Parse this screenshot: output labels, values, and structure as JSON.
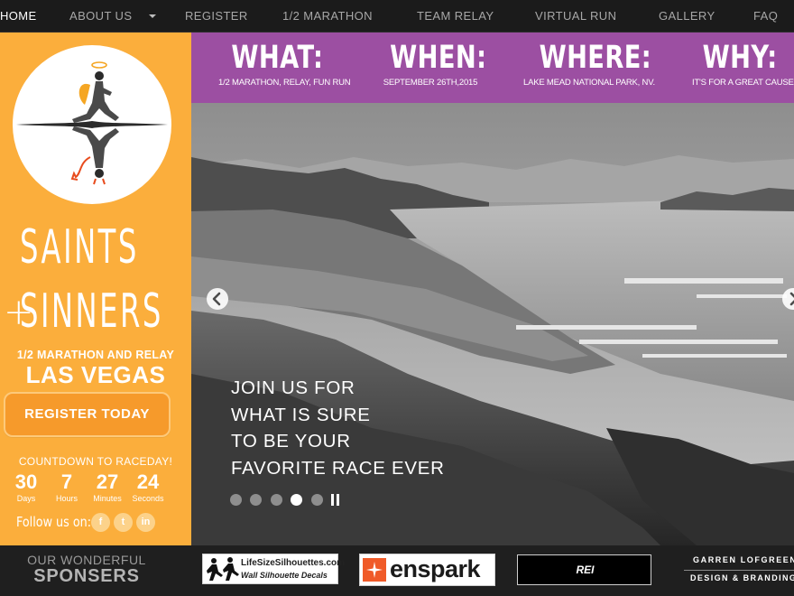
{
  "nav": {
    "items": [
      "HOME",
      "ABOUT US",
      "REGISTER",
      "1/2 MARATHON",
      "TEAM RELAY",
      "VIRTUAL RUN",
      "GALLERY",
      "FAQ"
    ],
    "active": "HOME"
  },
  "sidebar": {
    "brand_line1": "SAINTS",
    "brand_plus": "+",
    "brand_line2": "SINNERS",
    "subtitle": "1/2 MARATHON AND RELAY",
    "city": "LAS VEGAS",
    "register_label": "REGISTER TODAY",
    "countdown_title": "COUNTDOWN TO RACEDAY!",
    "countdown": [
      {
        "value": "30",
        "unit": "Days"
      },
      {
        "value": "7",
        "unit": "Hours"
      },
      {
        "value": "27",
        "unit": "Minutes"
      },
      {
        "value": "24",
        "unit": "Seconds"
      }
    ],
    "follow_label": "Follow us on:",
    "social": [
      {
        "icon": "facebook-icon",
        "glyph": "f"
      },
      {
        "icon": "twitter-icon",
        "glyph": "t"
      },
      {
        "icon": "linkedin-icon",
        "glyph": "in"
      }
    ]
  },
  "info": [
    {
      "head": "WHAT:",
      "sub": "1/2 MARATHON, RELAY, FUN RUN"
    },
    {
      "head": "WHEN:",
      "sub": "SEPTEMBER 26TH,2015"
    },
    {
      "head": "WHERE:",
      "sub": "LAKE MEAD NATIONAL PARK, NV."
    },
    {
      "head": "WHY:",
      "sub": "IT'S FOR A GREAT CAUSE"
    }
  ],
  "hero": {
    "lines": [
      "JOIN US FOR",
      "WHAT IS SURE",
      "TO BE YOUR",
      "FAVORITE RACE EVER"
    ],
    "slide_count": 5,
    "active_slide": 4
  },
  "sponsors": {
    "title_line1": "OUR WONDERFUL",
    "title_line2": "SPONSERS",
    "lifesize_line1": "LifeSizeSilhouettes.com",
    "lifesize_line2": "Wall Silhouette Decals",
    "enspark": "enspark",
    "rei": "REI",
    "garren_line1": "GARREN LOFGREEN",
    "garren_line2": "DESIGN & BRANDING"
  },
  "colors": {
    "orange": "#fbae3c",
    "purple": "#9c4fa2",
    "dark": "#1b1b1b"
  }
}
